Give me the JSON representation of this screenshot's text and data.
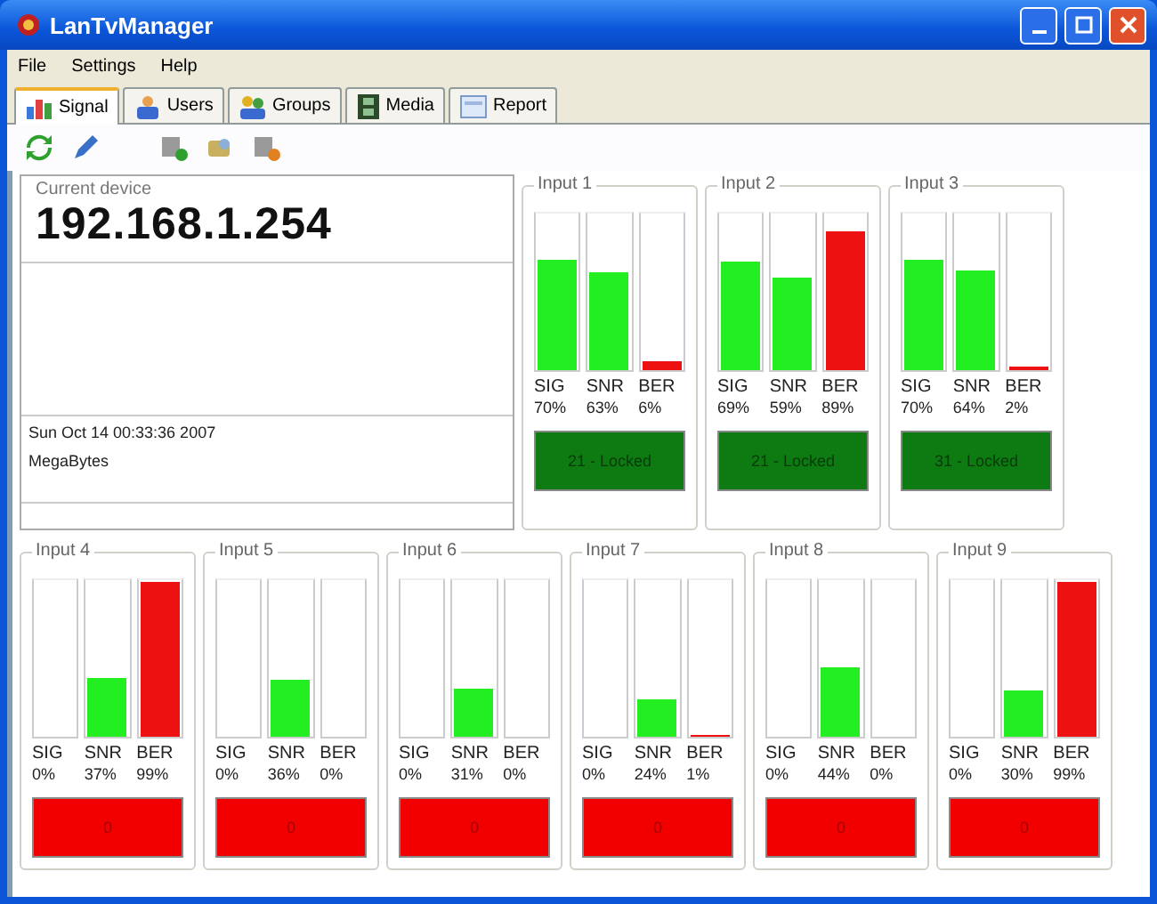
{
  "window": {
    "title": "LanTvManager"
  },
  "menu": [
    "File",
    "Settings",
    "Help"
  ],
  "tabs": [
    {
      "label": "Signal",
      "selected": true,
      "kind": "chart"
    },
    {
      "label": "Users",
      "selected": false,
      "kind": "users"
    },
    {
      "label": "Groups",
      "selected": false,
      "kind": "groups"
    },
    {
      "label": "Media",
      "selected": false,
      "kind": "film"
    },
    {
      "label": "Report",
      "selected": false,
      "kind": "report"
    }
  ],
  "device": {
    "caption": "Current device",
    "address": "192.168.1.254",
    "timestamp": "Sun Oct 14 00:33:36 2007",
    "unit": "MegaBytes"
  },
  "inputs": [
    {
      "title": "Input 1",
      "meters": [
        {
          "label": "SIG",
          "value": "70%",
          "level": 0.7,
          "kind": "signal"
        },
        {
          "label": "SNR",
          "value": "63%",
          "level": 0.63,
          "kind": "signal"
        },
        {
          "label": "BER",
          "value": "6%",
          "level": 0.06,
          "kind": "error"
        }
      ],
      "status": {
        "text": "21 - Locked",
        "locked": true
      }
    },
    {
      "title": "Input 2",
      "meters": [
        {
          "label": "SIG",
          "value": "69%",
          "level": 0.69,
          "kind": "signal"
        },
        {
          "label": "SNR",
          "value": "59%",
          "level": 0.59,
          "kind": "signal"
        },
        {
          "label": "BER",
          "value": "89%",
          "level": 0.89,
          "kind": "error"
        }
      ],
      "status": {
        "text": "21 - Locked",
        "locked": true
      }
    },
    {
      "title": "Input 3",
      "meters": [
        {
          "label": "SIG",
          "value": "70%",
          "level": 0.7,
          "kind": "signal"
        },
        {
          "label": "SNR",
          "value": "64%",
          "level": 0.64,
          "kind": "signal"
        },
        {
          "label": "BER",
          "value": "2%",
          "level": 0.02,
          "kind": "error"
        }
      ],
      "status": {
        "text": "31 - Locked",
        "locked": true
      }
    },
    {
      "title": "Input 4",
      "meters": [
        {
          "label": "SIG",
          "value": "0%",
          "level": 0,
          "kind": "signal"
        },
        {
          "label": "SNR",
          "value": "37%",
          "level": 0.37,
          "kind": "signal"
        },
        {
          "label": "BER",
          "value": "99%",
          "level": 0.99,
          "kind": "error"
        }
      ],
      "status": {
        "text": "0",
        "locked": false
      }
    },
    {
      "title": "Input 5",
      "meters": [
        {
          "label": "SIG",
          "value": "0%",
          "level": 0,
          "kind": "signal"
        },
        {
          "label": "SNR",
          "value": "36%",
          "level": 0.36,
          "kind": "signal"
        },
        {
          "label": "BER",
          "value": "0%",
          "level": 0,
          "kind": "error"
        }
      ],
      "status": {
        "text": "0",
        "locked": false
      }
    },
    {
      "title": "Input 6",
      "meters": [
        {
          "label": "SIG",
          "value": "0%",
          "level": 0,
          "kind": "signal"
        },
        {
          "label": "SNR",
          "value": "31%",
          "level": 0.31,
          "kind": "signal"
        },
        {
          "label": "BER",
          "value": "0%",
          "level": 0,
          "kind": "error"
        }
      ],
      "status": {
        "text": "0",
        "locked": false
      }
    },
    {
      "title": "Input 7",
      "meters": [
        {
          "label": "SIG",
          "value": "0%",
          "level": 0,
          "kind": "signal"
        },
        {
          "label": "SNR",
          "value": "24%",
          "level": 0.24,
          "kind": "signal"
        },
        {
          "label": "BER",
          "value": "1%",
          "level": 0.01,
          "kind": "error"
        }
      ],
      "status": {
        "text": "0",
        "locked": false
      }
    },
    {
      "title": "Input 8",
      "meters": [
        {
          "label": "SIG",
          "value": "0%",
          "level": 0,
          "kind": "signal"
        },
        {
          "label": "SNR",
          "value": "44%",
          "level": 0.44,
          "kind": "signal"
        },
        {
          "label": "BER",
          "value": "0%",
          "level": 0,
          "kind": "error"
        }
      ],
      "status": {
        "text": "0",
        "locked": false
      }
    },
    {
      "title": "Input 9",
      "meters": [
        {
          "label": "SIG",
          "value": "0%",
          "level": 0,
          "kind": "signal"
        },
        {
          "label": "SNR",
          "value": "30%",
          "level": 0.3,
          "kind": "signal"
        },
        {
          "label": "BER",
          "value": "99%",
          "level": 0.99,
          "kind": "error"
        }
      ],
      "status": {
        "text": "0",
        "locked": false
      }
    }
  ]
}
